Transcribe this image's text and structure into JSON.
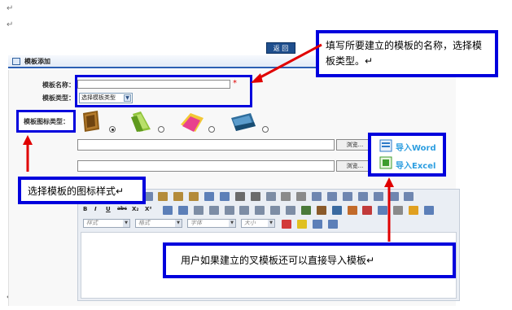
{
  "paragraph_marks": [
    "↵",
    "↵",
    "↵"
  ],
  "back_button": "返 回",
  "titlebar": {
    "title": "模板添加"
  },
  "form": {
    "name_label": "模板名称：",
    "required_mark": "*",
    "type_label": "模板类型：",
    "type_select": "选择模板类型",
    "icon_type_label": "模板图标类型：",
    "browse_1": "浏览...",
    "browse_2": "浏览..."
  },
  "import": {
    "word": "导入Word",
    "excel": "导入Excel"
  },
  "callouts": {
    "top_right": "填写所要建立的模板的名称，选择模板类型。↵",
    "left": "选择模板的图标样式↵",
    "bottom": "用户如果建立的叉模板还可以直接导入模板↵"
  },
  "editor": {
    "format_buttons": [
      "B",
      "I",
      "U",
      "abc",
      "X₂",
      "X²"
    ],
    "combos": [
      "样式",
      "格式",
      "字体",
      "大小"
    ]
  },
  "icon_options": [
    {
      "icon": "brown-folder-icon",
      "selected": true
    },
    {
      "icon": "green-folder-icon",
      "selected": false
    },
    {
      "icon": "pink-folder-icon",
      "selected": false
    },
    {
      "icon": "blue-folder-icon",
      "selected": false
    }
  ],
  "colors": {
    "callout_border": "#0000dd",
    "arrow": "#e00000",
    "titlebar_accent": "#2b5fb3",
    "import_text": "#2d9ee0"
  }
}
